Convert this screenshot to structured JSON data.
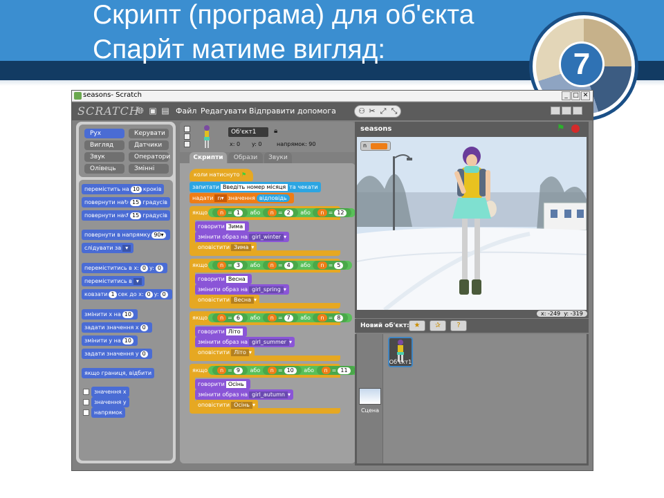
{
  "slide": {
    "title_line1": "Скрипт (програма) для об'єкта",
    "title_line2": "Спарйт  матиме вигляд:",
    "badge_number": "7"
  },
  "window": {
    "title": "seasons- Scratch",
    "btn_min": "_",
    "btn_max": "□",
    "btn_close": "✕"
  },
  "menu": {
    "logo": "SCRATCH",
    "items": [
      "Файл",
      "Редагувати",
      "Відправити",
      "допомога"
    ]
  },
  "categories": [
    "Рух",
    "Вигляд",
    "Звук",
    "Олівець",
    "Керувати",
    "Датчики",
    "Оператори",
    "Змінні"
  ],
  "palette": {
    "move": "перемістить на",
    "move_val": "10",
    "move_suffix": "кроків",
    "turn_cw": "повернути на",
    "turn_cw_val": "15",
    "turn_suffix": "градусів",
    "turn_ccw": "повернути на",
    "turn_ccw_val": "15",
    "point_dir": "повернути в напрямку",
    "point_dir_val": "90▾",
    "follow": "слідувати за",
    "goto_xy": "переміститись в x:",
    "goto_x": "0",
    "goto_y_label": "y:",
    "goto_y": "0",
    "goto": "переміститись в",
    "glide": "ковзати",
    "glide_val": "1",
    "glide_mid": "сек до x:",
    "glide_x": "0",
    "glide_y_label": "y:",
    "glide_y": "0",
    "change_x": "змінити x на",
    "change_x_val": "10",
    "set_x": "задати значення x",
    "set_x_val": "0",
    "change_y": "змінити y на",
    "change_y_val": "10",
    "set_y": "задати значення y",
    "set_y_val": "0",
    "bounce": "якщо границя, відбити",
    "rep_x": "значення x",
    "rep_y": "значення y",
    "rep_dir": "напрямок"
  },
  "sprite": {
    "name": "Об'єкт1",
    "x_label": "x:",
    "x": "0",
    "y_label": "y:",
    "y": "0",
    "dir_label": "напрямок:",
    "dir": "90"
  },
  "tabs": [
    "Скрипти",
    "Образи",
    "Звуки"
  ],
  "script": {
    "hat": "коли натиснуто",
    "ask": "запитати",
    "ask_text": "Введіть номер місяця",
    "ask_wait": "та чекати",
    "set": "надати",
    "set_var": "n▾",
    "set_mid": "значення",
    "set_answer": "відповідь",
    "if_label": "якщо",
    "or": "або",
    "eq": "=",
    "var": "n",
    "say": "говорити",
    "costume": "змінити образ на",
    "broadcast": "оповістити",
    "seasons": [
      {
        "n1": "1",
        "n2": "2",
        "n3": "12",
        "say": "Зима",
        "costume": "girl_winter",
        "msg": "Зима"
      },
      {
        "n1": "3",
        "n2": "4",
        "n3": "5",
        "say": "Весна",
        "costume": "girl_spring",
        "msg": "Весна"
      },
      {
        "n1": "6",
        "n2": "7",
        "n3": "8",
        "say": "Літо",
        "costume": "girl_summer",
        "msg": "Літо"
      },
      {
        "n1": "9",
        "n2": "10",
        "n3": "11",
        "say": "Осінь",
        "costume": "girl_autumn",
        "msg": "Осінь"
      }
    ]
  },
  "stage": {
    "title": "seasons",
    "monitor_var": "n",
    "coord_x_label": "x:",
    "coord_x": "-249",
    "coord_y_label": "y:",
    "coord_y": "-319"
  },
  "new_sprite": {
    "label": "Новий об'єкт:"
  },
  "sprite_list": {
    "sprite_label": "Об'єкт1",
    "stage_label": "Сцена"
  },
  "colors": {
    "motion": "#4a6cd4",
    "looks": "#8a55d7",
    "sound": "#bb42c3",
    "pen": "#0e9a6c",
    "control": "#e6a822",
    "sensing": "#2ca5e2",
    "operators": "#5cb712",
    "variables": "#ee7d16"
  }
}
